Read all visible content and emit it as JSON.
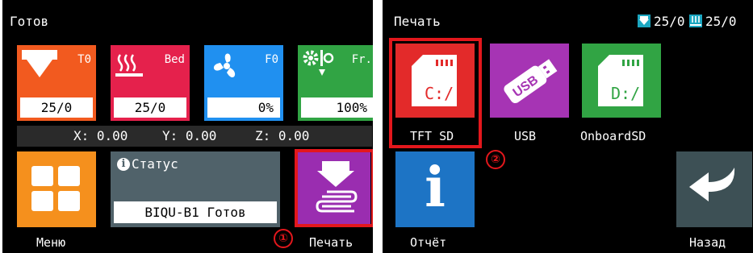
{
  "left": {
    "title": "Готов",
    "tiles": {
      "t0": {
        "name": "T0",
        "value": "25/0",
        "color": "#f25a1f"
      },
      "bed": {
        "name": "Bed",
        "value": "25/0",
        "color": "#e5214c"
      },
      "f0": {
        "name": "F0",
        "value": "0%",
        "color": "#2090f0"
      },
      "fr": {
        "name": "Fr.",
        "value": "100%",
        "color": "#31a444"
      }
    },
    "coords": {
      "x": "X: 0.00",
      "y": "Y: 0.00",
      "z": "Z: 0.00"
    },
    "status": {
      "title": "Статус",
      "message": "BIQU-B1 Готов",
      "color": "#50626a"
    },
    "menu_label": "Меню",
    "print_label": "Печать",
    "marker": "①"
  },
  "right": {
    "title": "Печать",
    "nozzle_temp": "25/0",
    "bed_temp": "25/0",
    "items": {
      "tft_sd": {
        "label": "TFT SD",
        "text": "C:/",
        "color": "#e32a2a"
      },
      "usb": {
        "label": "USB",
        "text": "USB",
        "color": "#a634b4"
      },
      "onboard": {
        "label": "OnboardSD",
        "text": "D:/",
        "color": "#31a444"
      }
    },
    "report_label": "Отчёт",
    "back_label": "Назад",
    "marker": "②"
  },
  "colors": {
    "highlight": "#e3171c",
    "menu": "#f5901d",
    "print": "#9a2db0",
    "report": "#1d74c5",
    "back": "#3d5055"
  }
}
